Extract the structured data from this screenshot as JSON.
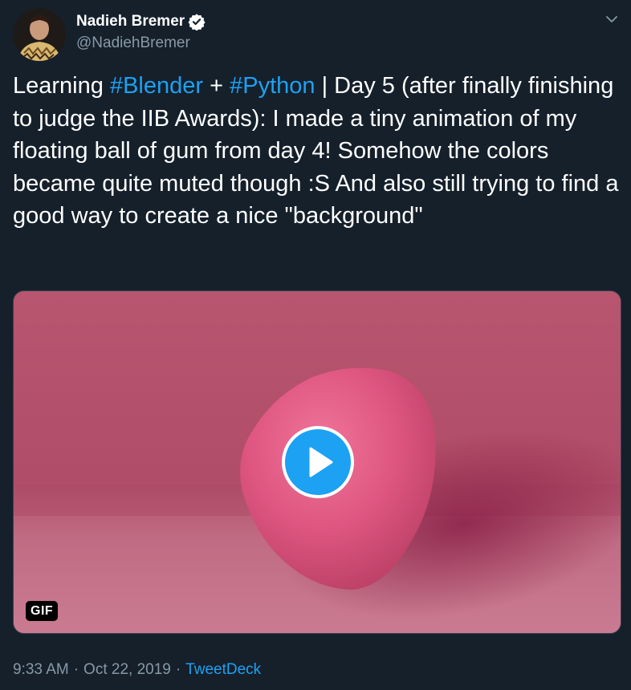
{
  "author": {
    "display_name": "Nadieh Bremer",
    "handle": "@NadiehBremer",
    "verified": true
  },
  "tweet": {
    "text_parts": {
      "p1": "Learning ",
      "p2": "#Blender",
      "p3": " + ",
      "p4": "#Python",
      "p5": " | Day 5 (after finally finishing to judge the IIB Awards): I made a tiny animation of my floating ball of gum from day 4! Somehow the colors became quite muted though :S And also still trying to find a good way to create a nice \"background\""
    },
    "hashtag_color": "#1da1f2"
  },
  "media": {
    "badge": "GIF",
    "background_color": "#b7546f",
    "object_color": "#e0587f"
  },
  "meta": {
    "time": "9:33 AM",
    "separator1": "·",
    "date": "Oct 22, 2019",
    "separator2": "·",
    "source": "TweetDeck"
  },
  "icons": {
    "verified": "verified-badge-icon",
    "caret": "chevron-down-icon",
    "play": "play-icon"
  },
  "colors": {
    "background": "#15202b",
    "secondary_text": "#8899a6",
    "accent": "#1da1f2"
  }
}
